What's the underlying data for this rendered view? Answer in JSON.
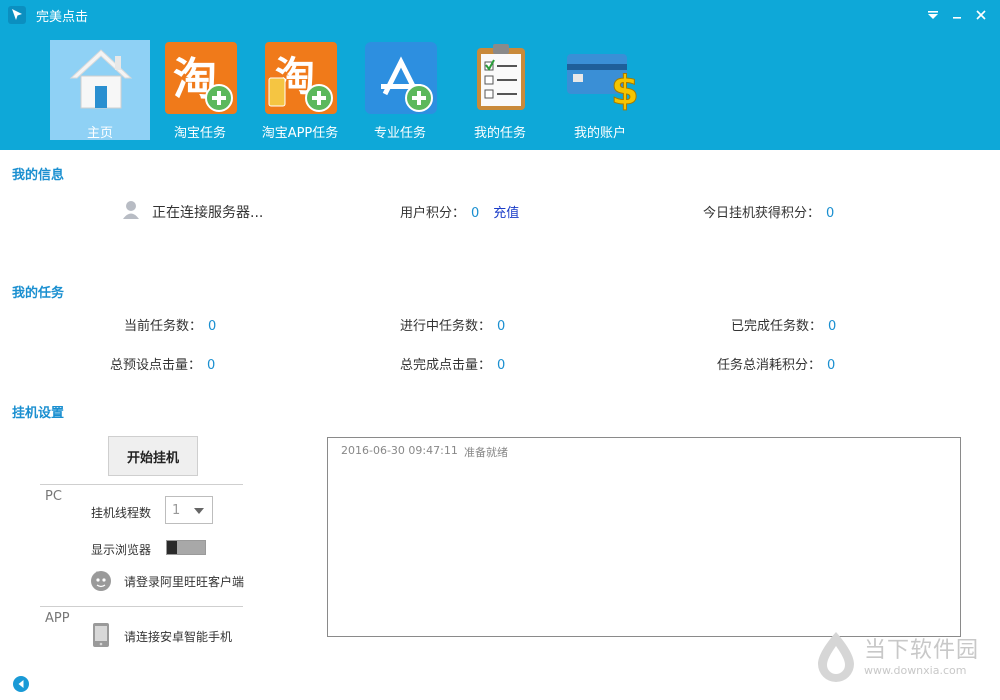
{
  "window": {
    "title": "完美点击",
    "controls": [
      "menu-icon",
      "minimize-icon",
      "close-icon"
    ]
  },
  "toolbar": {
    "items": [
      {
        "label": "主页",
        "icon": "home-icon",
        "active": true
      },
      {
        "label": "淘宝任务",
        "icon": "taobao-add-icon",
        "active": false
      },
      {
        "label": "淘宝APP任务",
        "icon": "taobao-app-add-icon",
        "active": false
      },
      {
        "label": "专业任务",
        "icon": "appstore-add-icon",
        "active": false
      },
      {
        "label": "我的任务",
        "icon": "clipboard-checklist-icon",
        "active": false
      },
      {
        "label": "我的账户",
        "icon": "card-dollar-icon",
        "active": false
      }
    ]
  },
  "my_info": {
    "title": "我的信息",
    "status": "正在连接服务器...",
    "points_label": "用户积分：",
    "points_value": "0",
    "recharge": "充值",
    "today_label": "今日挂机获得积分：",
    "today_value": "0"
  },
  "my_tasks": {
    "title": "我的任务",
    "current_label": "当前任务数：",
    "current_value": "0",
    "inprogress_label": "进行中任务数：",
    "inprogress_value": "0",
    "done_label": "已完成任务数：",
    "done_value": "0",
    "preset_clicks_label": "总预设点击量：",
    "preset_clicks_value": "0",
    "done_clicks_label": "总完成点击量：",
    "done_clicks_value": "0",
    "spent_label": "任务总消耗积分：",
    "spent_value": "0"
  },
  "settings": {
    "title": "挂机设置",
    "start_button": "开始挂机",
    "pc_label": "PC",
    "threads_label": "挂机线程数",
    "threads_value": "1",
    "show_browser_label": "显示浏览器",
    "show_browser_on": false,
    "wangwang_hint": "请登录阿里旺旺客户端",
    "app_label": "APP",
    "phone_hint": "请连接安卓智能手机"
  },
  "log": {
    "entries": [
      {
        "time": "2016-06-30 09:47:11",
        "message": "准备就绪"
      }
    ]
  },
  "watermark": {
    "name": "当下软件园",
    "url": "www.downxia.com"
  },
  "colors": {
    "header_bg": "#0ea8d8",
    "active_tab": "#8fd1f5",
    "section_title": "#1a8fd0",
    "value": "#1a8fd0",
    "link": "#1a3cc8"
  }
}
